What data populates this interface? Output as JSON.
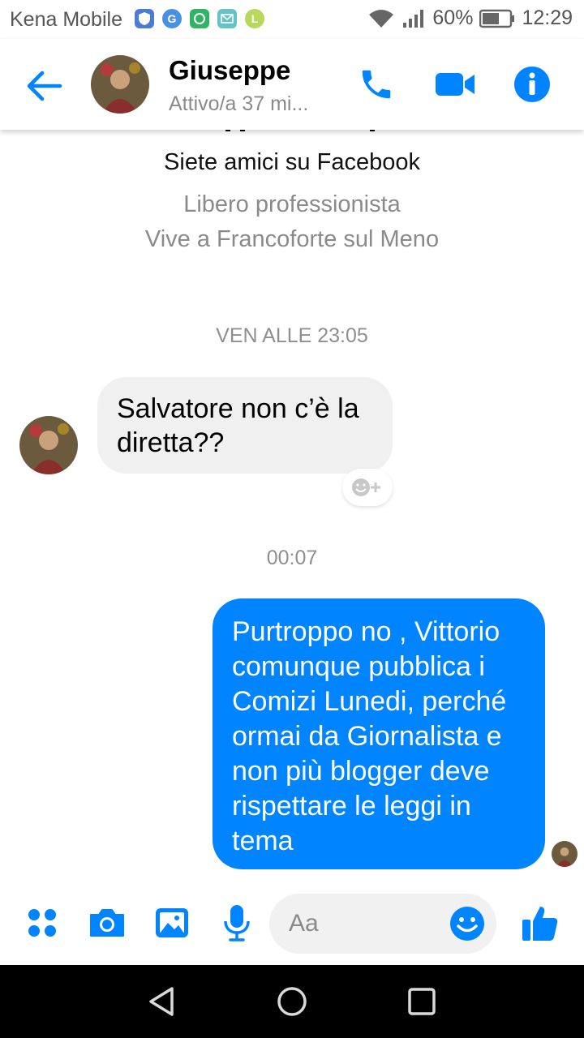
{
  "status_bar": {
    "carrier": "Kena Mobile",
    "battery": "60%",
    "time": "12:29",
    "notification_icons": [
      "shield-icon",
      "google-icon",
      "hangouts-icon",
      "mail-icon",
      "line-icon"
    ]
  },
  "header": {
    "name": "Giuseppe",
    "status": "Attivo/a 37 mi...",
    "actions": [
      "phone-icon",
      "video-camera-icon",
      "info-icon"
    ]
  },
  "profile": {
    "friends_text": "Siete amici su Facebook",
    "occupation": "Libero professionista",
    "location": "Vive a Francoforte sul Meno"
  },
  "messages": {
    "timestamp_1": "VEN ALLE 23:05",
    "incoming_text": "Salvatore non c’è la diretta??",
    "timestamp_2": "00:07",
    "outgoing_text": "Purtroppo no , Vittorio comunque pubblica i Comizi Lunedi, perché ormai da Giornalista e non più blogger deve rispettare le leggi in tema"
  },
  "composer": {
    "placeholder": "Aa",
    "actions": [
      "more-icon",
      "camera-icon",
      "gallery-icon",
      "microphone-icon",
      "emoji-icon",
      "thumbs-up-icon"
    ]
  },
  "colors": {
    "accent": "#0084ff",
    "incoming_bubble": "#f0f0f0",
    "secondary_text": "#8a8a8a"
  }
}
